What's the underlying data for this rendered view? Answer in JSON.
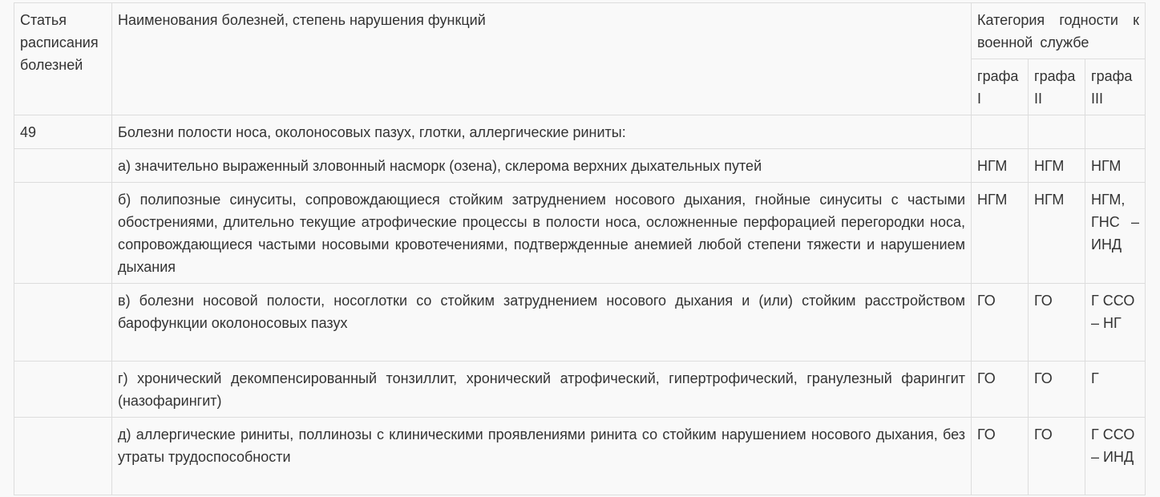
{
  "table": {
    "header": {
      "article": "Статья расписания болезней",
      "diseases": "Наименования болезней, степень нарушения функций",
      "category": "Категория годности к военной службе",
      "columns": [
        "графа I",
        "графа II",
        "графа III"
      ]
    },
    "article_number": "49",
    "section_title": "Болезни полости носа, околоносовых пазух, глотки, аллергические риниты:",
    "rows": [
      {
        "text": "а) значительно выраженный зловонный насморк (озена), склерома верхних дыхательных путей",
        "g1": "НГМ",
        "g2": "НГМ",
        "g3": "НГМ"
      },
      {
        "text": "б) полипозные синуситы, сопровождающиеся стойким затруднением носового дыхания, гнойные синуситы с частыми обострениями, длительно текущие атрофические процессы в полости носа, осложненные перфорацией перегородки носа, сопровождающиеся частыми носовыми кровотечениями, подтвержденные анемией любой степени тяжести и нарушением дыхания",
        "g1": "НГМ",
        "g2": "НГМ",
        "g3": "НГМ, ГНС – ИНД"
      },
      {
        "text": "в) болезни носовой полости, носоглотки со стойким затруднением носового дыхания и (или) стойким расстройством барофункции околоносовых пазух",
        "g1": "ГО",
        "g2": "ГО",
        "g3": "Г ССО – НГ"
      },
      {
        "text": "г) хронический декомпенсированный тонзиллит, хронический атрофический, гипертрофический, гранулезный фарингит (назофарингит)",
        "g1": "ГО",
        "g2": "ГО",
        "g3": "Г"
      },
      {
        "text": "д) аллергические риниты, поллинозы с клиническими проявлениями ринита со стойким нарушением носового дыхания, без утраты трудоспособности",
        "g1": "ГО",
        "g2": "ГО",
        "g3": "Г ССО – ИНД"
      }
    ]
  }
}
